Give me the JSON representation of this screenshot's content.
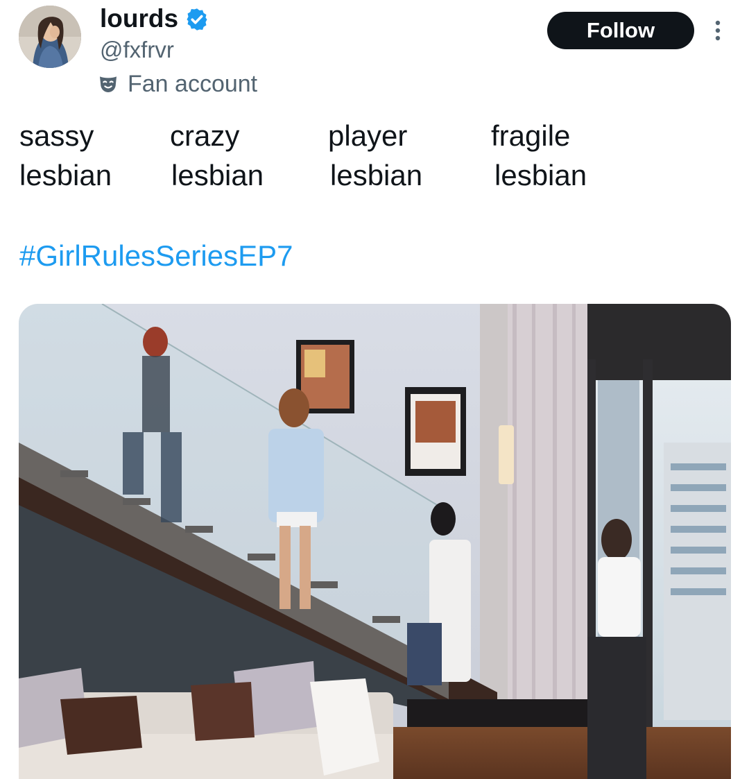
{
  "author": {
    "display_name": "lourds",
    "handle": "@fxfrvr",
    "verified": true,
    "account_label": "Fan account",
    "avatar_icon": "profile-photo"
  },
  "actions": {
    "follow_label": "Follow",
    "more_icon": "more-options-icon"
  },
  "tweet": {
    "words": [
      [
        "sassy",
        "lesbian"
      ],
      [
        "crazy",
        "lesbian"
      ],
      [
        "player",
        "lesbian"
      ],
      [
        "fragile",
        "lesbian"
      ]
    ],
    "hashtag": "#GirlRulesSeriesEP7"
  },
  "colors": {
    "text": "#0f1419",
    "secondary": "#536471",
    "link": "#1d9bf0",
    "verified": "#1d9bf0",
    "button": "#0f1419"
  }
}
